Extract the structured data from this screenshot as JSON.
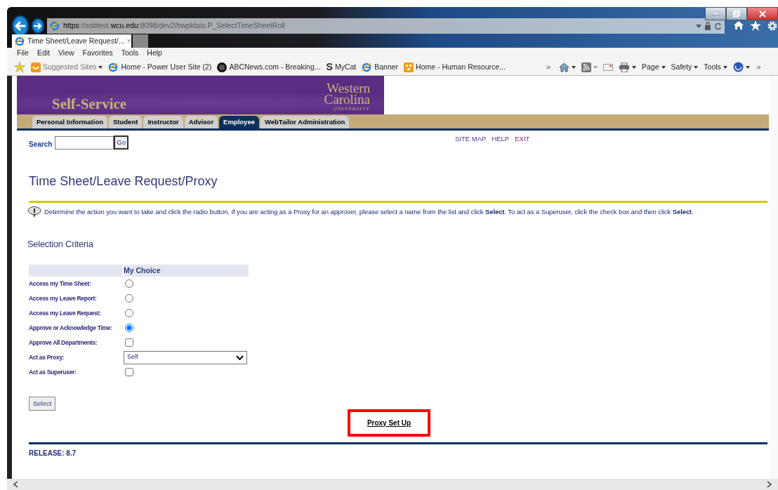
{
  "address_bar": {
    "segments": [
      {
        "text": "https",
        "emphasis": true
      },
      {
        "text": "://ssbtest.",
        "emphasis": false
      },
      {
        "text": "wcu.edu",
        "emphasis": true
      },
      {
        "text": ":8098/dev2/bwpktais.P_SelectTimeSheetRoll",
        "emphasis": false
      }
    ]
  },
  "tabs": [
    {
      "title": "Time Sheet/Leave Request/...",
      "close": "×",
      "selected": true
    }
  ],
  "menu_bar": [
    "File",
    "Edit",
    "View",
    "Favorites",
    "Tools",
    "Help"
  ],
  "favorites_bar": {
    "items": [
      {
        "label": "Suggested Sites",
        "kind": "suggested",
        "dropdown": true
      },
      {
        "label": "Home - Power User Site (2)",
        "kind": "page",
        "dropdown": false
      },
      {
        "label": "ABCNews.com - Breaking...",
        "kind": "news",
        "dropdown": false
      },
      {
        "label": "MyCat",
        "kind": "glyph",
        "glyph": "S",
        "dropdown": false
      },
      {
        "label": "Banner",
        "kind": "page",
        "dropdown": false
      },
      {
        "label": "Home - Human Resource...",
        "kind": "grid",
        "dropdown": false
      }
    ],
    "overflow": "»"
  },
  "command_bar": {
    "items": [
      {
        "kind": "home"
      },
      {
        "kind": "feeds"
      },
      {
        "kind": "mail"
      },
      {
        "kind": "print"
      },
      {
        "kind": "menu",
        "label": "Page"
      },
      {
        "kind": "menu",
        "label": "Safety"
      },
      {
        "kind": "menu",
        "label": "Tools"
      },
      {
        "kind": "help"
      }
    ],
    "overflow": "»"
  },
  "page": {
    "banner": {
      "title": "Self-Service",
      "logo": [
        "Western",
        "Carolina",
        "UNIVERSITY"
      ]
    },
    "nav_tabs": [
      {
        "label": "Personal Information",
        "selected": false
      },
      {
        "label": "Student",
        "selected": false
      },
      {
        "label": "Instructor",
        "selected": false
      },
      {
        "label": "Advisor",
        "selected": false
      },
      {
        "label": "Employee",
        "selected": true
      },
      {
        "label": "WebTailor Administration",
        "selected": false
      }
    ],
    "search": {
      "label": "Search",
      "button": "Go"
    },
    "links": [
      "SITE MAP",
      "HELP",
      "EXIT"
    ],
    "heading": "Time Sheet/Leave Request/Proxy",
    "info": "Determine the action you want to take and click the radio button. If you are acting as a Proxy for an approver, please select a name from the list and click **Select**. To act as a Superuser, click the check box and then click **Select**.",
    "section_title": "Selection Criteria",
    "criteria": {
      "header": "My Choice",
      "rows": [
        {
          "label": "Access my Time Sheet:",
          "kind": "radio",
          "checked": false
        },
        {
          "label": "Access my Leave Report:",
          "kind": "radio",
          "checked": false
        },
        {
          "label": "Access my Leave Request:",
          "kind": "radio",
          "checked": false
        },
        {
          "label": "Approve or Acknowledge Time:",
          "kind": "radio",
          "checked": true
        },
        {
          "label": "Approve All Departments:",
          "kind": "checkbox",
          "checked": false
        },
        {
          "label": "Act as Proxy:",
          "kind": "select",
          "value": "Self"
        },
        {
          "label": "Act as Superuser:",
          "kind": "checkbox",
          "checked": false
        }
      ]
    },
    "select_button": "Select",
    "proxy_link": {
      "label": "Proxy Set Up",
      "highlighted": true
    },
    "release": "RELEASE: 8.7"
  }
}
